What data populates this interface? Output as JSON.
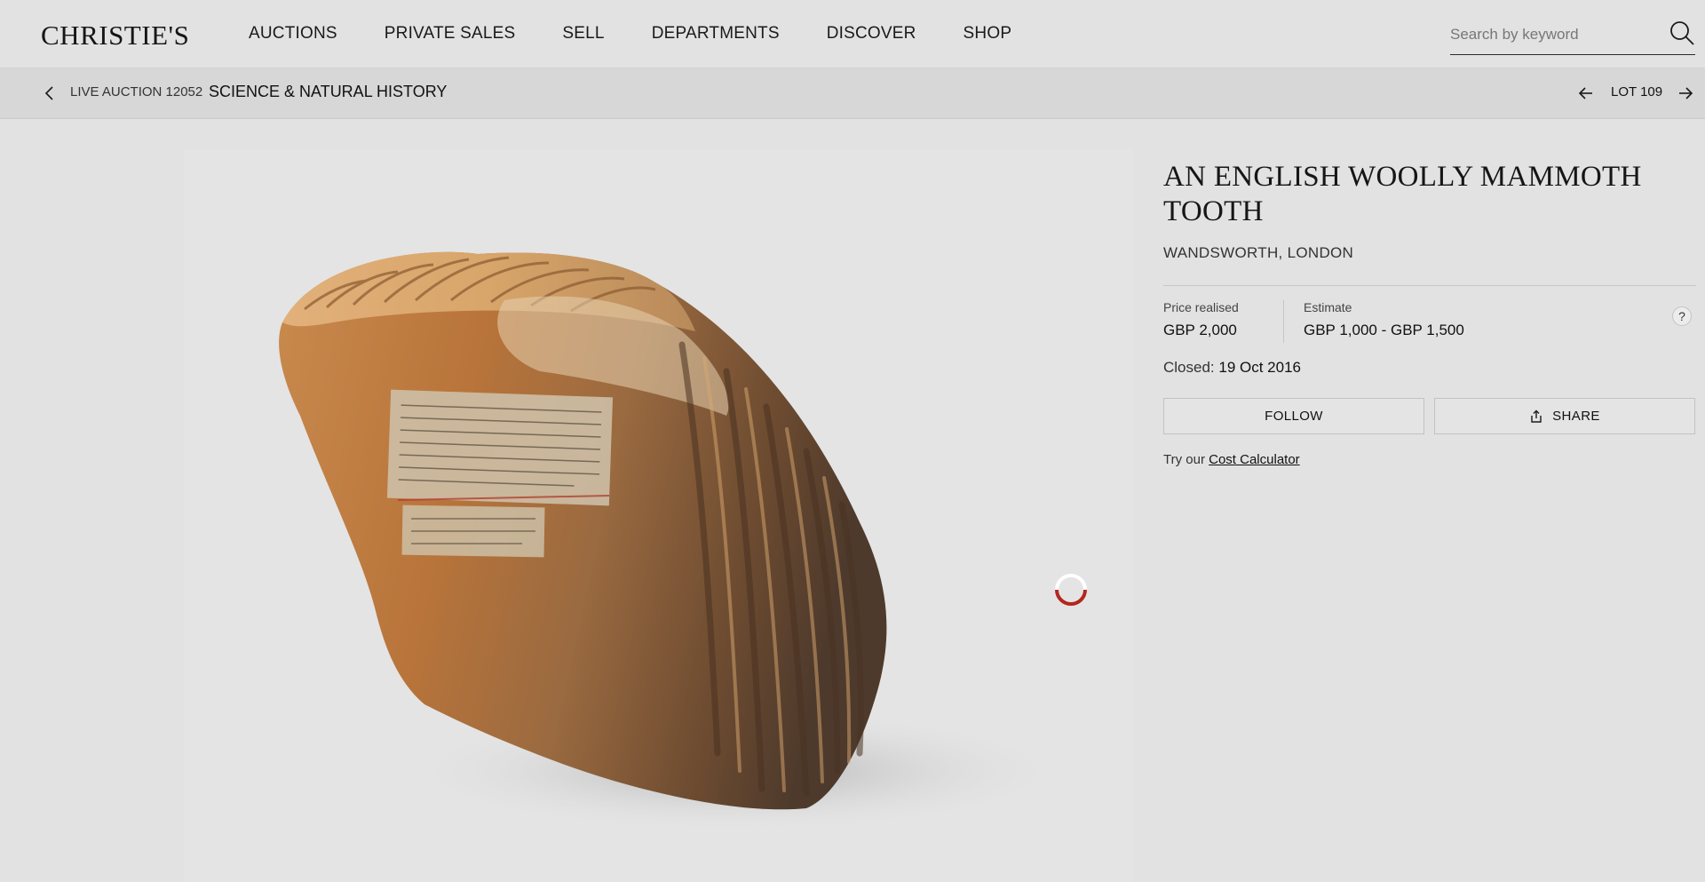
{
  "header": {
    "logo": "CHRISTIE'S",
    "nav": [
      "AUCTIONS",
      "PRIVATE SALES",
      "SELL",
      "DEPARTMENTS",
      "DISCOVER",
      "SHOP"
    ],
    "search_placeholder": "Search by keyword"
  },
  "breadcrumb": {
    "auction_label": "LIVE AUCTION 12052",
    "auction_title": "SCIENCE & NATURAL HISTORY",
    "lot_label": "LOT 109"
  },
  "lot": {
    "title": "AN ENGLISH WOOLLY MAMMOTH TOOTH",
    "subtitle": "WANDSWORTH, LONDON",
    "price_realised_label": "Price realised",
    "price_realised_value": "GBP 2,000",
    "estimate_label": "Estimate",
    "estimate_value": "GBP 1,000 - GBP 1,500",
    "help_label": "?",
    "closed_label": "Closed:",
    "closed_date": "19 Oct 2016",
    "follow_label": "FOLLOW",
    "share_label": "SHARE",
    "try_prefix": "Try our",
    "cost_calculator_label": "Cost Calculator"
  },
  "colors": {
    "background": "#e2e2e2",
    "breadcrumb_bg": "#d7d7d7",
    "spinner_accent": "#b3261e"
  }
}
